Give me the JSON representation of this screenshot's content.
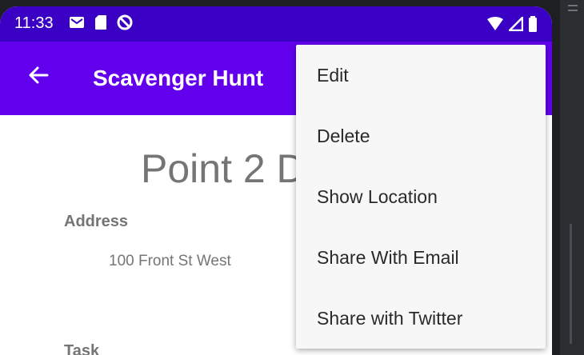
{
  "status_bar": {
    "time": "11:33",
    "icons_left": [
      "gmail-icon",
      "sd-card-icon",
      "data-saver-icon"
    ],
    "icons_right": [
      "wifi-icon",
      "cell-signal-icon",
      "battery-icon"
    ],
    "color": "#3a00c4"
  },
  "app_bar": {
    "title": "Scavenger Hunt",
    "back_icon": "arrow-back-icon",
    "color": "#6200ee"
  },
  "content": {
    "heading": "Point 2 D",
    "address_label": "Address",
    "address_value": "100 Front St West",
    "task_label": "Task"
  },
  "menu": {
    "items": [
      "Edit",
      "Delete",
      "Show Location",
      "Share With Email",
      "Share with Twitter"
    ]
  }
}
